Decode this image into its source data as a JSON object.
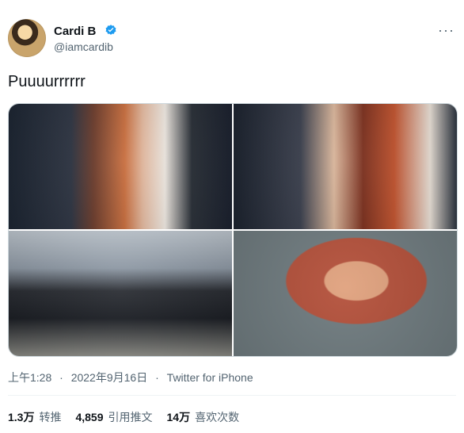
{
  "author": {
    "name": "Cardi B",
    "handle": "@iamcardib",
    "verified_color": "#1d9bf0"
  },
  "tweet": {
    "text": "Puuuurrrrrr",
    "time": "上午1:28",
    "date": "2022年9月16日",
    "source": "Twitter for iPhone",
    "more_icon": "more-icon"
  },
  "stats": {
    "retweets_value": "1.3万",
    "retweets_label": "转推",
    "quotes_value": "4,859",
    "quotes_label": "引用推文",
    "likes_value": "14万",
    "likes_label": "喜欢次数"
  },
  "colors": {
    "text_primary": "#0f1419",
    "text_secondary": "#536471",
    "border": "#cfd9de"
  }
}
